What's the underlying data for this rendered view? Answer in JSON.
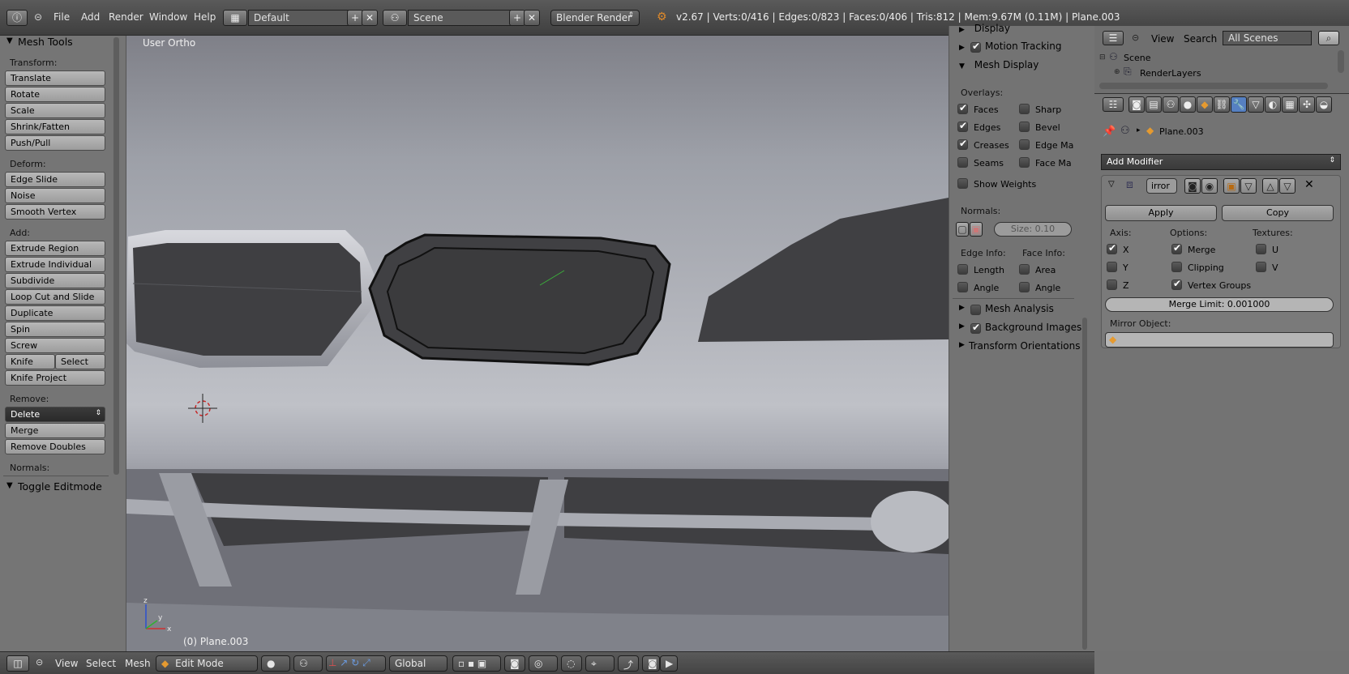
{
  "topbar": {
    "menus": [
      "File",
      "Add",
      "Render",
      "Window",
      "Help"
    ],
    "screen_layout": "Default",
    "scene": "Scene",
    "render_engine": "Blender Render",
    "status": "v2.67 | Verts:0/416 | Edges:0/823 | Faces:0/406 | Tris:812 | Mem:9.67M (0.11M) | Plane.003"
  },
  "toolshelf": {
    "title": "Mesh Tools",
    "transform_label": "Transform:",
    "transform": [
      "Translate",
      "Rotate",
      "Scale",
      "Shrink/Fatten",
      "Push/Pull"
    ],
    "deform_label": "Deform:",
    "deform": [
      "Edge Slide",
      "Noise",
      "Smooth Vertex"
    ],
    "add_label": "Add:",
    "add": [
      "Extrude Region",
      "Extrude Individual",
      "Subdivide",
      "Loop Cut and Slide",
      "Duplicate",
      "Spin",
      "Screw"
    ],
    "knife": "Knife",
    "select": "Select",
    "knife_project": "Knife Project",
    "remove_label": "Remove:",
    "delete": "Delete",
    "merge": "Merge",
    "remove_doubles": "Remove Doubles",
    "normals_label": "Normals:",
    "toggle_editmode": "Toggle Editmode"
  },
  "viewport": {
    "view_name": "User Ortho",
    "object_label": "(0) Plane.003",
    "axis_x": "x",
    "axis_y": "y",
    "axis_z": "z"
  },
  "npanel": {
    "display": "Display",
    "motion_tracking": "Motion Tracking",
    "mesh_display": "Mesh Display",
    "overlays_label": "Overlays:",
    "overlays": [
      {
        "label": "Faces",
        "checked": true
      },
      {
        "label": "Edges",
        "checked": true
      },
      {
        "label": "Creases",
        "checked": true
      },
      {
        "label": "Seams",
        "checked": false
      }
    ],
    "overlays_right": [
      {
        "label": "Sharp",
        "checked": false
      },
      {
        "label": "Bevel",
        "checked": false
      },
      {
        "label": "Edge Ma",
        "checked": false
      },
      {
        "label": "Face Ma",
        "checked": false
      }
    ],
    "show_weights": "Show Weights",
    "normals_label": "Normals:",
    "size_field": "Size: 0.10",
    "edge_info_label": "Edge Info:",
    "face_info_label": "Face Info:",
    "edge_length": "Length",
    "edge_angle": "Angle",
    "face_area": "Area",
    "face_angle": "Angle",
    "mesh_analysis": "Mesh Analysis",
    "background_images": "Background Images",
    "transform_orientations": "Transform Orientations"
  },
  "outliner": {
    "view": "View",
    "search": "Search",
    "filter": "All Scenes",
    "scene": "Scene",
    "render_layers": "RenderLayers"
  },
  "properties": {
    "object_name": "Plane.003",
    "add_modifier": "Add Modifier",
    "modifier_name": "irror",
    "apply": "Apply",
    "copy": "Copy",
    "axis_label": "Axis:",
    "options_label": "Options:",
    "textures_label": "Textures:",
    "axis": [
      {
        "label": "X",
        "checked": true
      },
      {
        "label": "Y",
        "checked": false
      },
      {
        "label": "Z",
        "checked": false
      }
    ],
    "options": [
      {
        "label": "Merge",
        "checked": true
      },
      {
        "label": "Clipping",
        "checked": false
      },
      {
        "label": "Vertex Groups",
        "checked": true
      }
    ],
    "textures": [
      {
        "label": "U",
        "checked": false
      },
      {
        "label": "V",
        "checked": false
      }
    ],
    "merge_limit": "Merge Limit: 0.001000",
    "mirror_object_label": "Mirror Object:"
  },
  "bottombar": {
    "menus": [
      "View",
      "Select",
      "Mesh"
    ],
    "mode": "Edit Mode",
    "orientation": "Global"
  },
  "colors": {
    "accent_blue": "#5680c2",
    "panel_bg": "#737373",
    "header_bg": "#4a4a4a"
  }
}
